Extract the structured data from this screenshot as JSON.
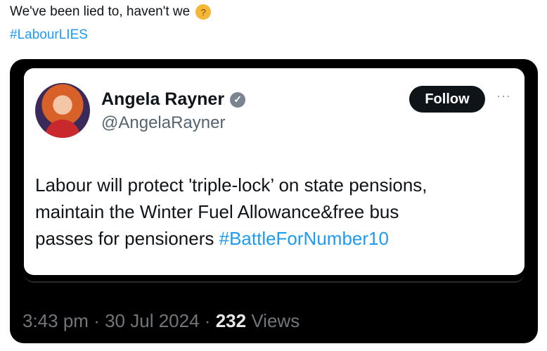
{
  "post": {
    "caption": "We've been lied to, haven't we",
    "caption_emoji": "thinking-face",
    "hashtag": "#LabourLIES"
  },
  "embedded_tweet": {
    "author_name": "Angela Rayner",
    "author_handle": "@AngelaRayner",
    "verified": true,
    "follow_label": "Follow",
    "more_label": "···",
    "text_line1": "Labour will protect 'triple-lock’ on state pensions,",
    "text_line2": "maintain the Winter Fuel Allowance&free bus",
    "text_line3": "passes for pensioners",
    "text_hashtag": "#BattleForNumber10",
    "time": "3:43 pm",
    "separator": "·",
    "date": "30 Jul 2024",
    "views_count": "232",
    "views_label": "Views"
  },
  "colors": {
    "link": "#1d9bf0",
    "text": "#0f1419",
    "muted": "#536471",
    "dark_bg": "#000000"
  }
}
